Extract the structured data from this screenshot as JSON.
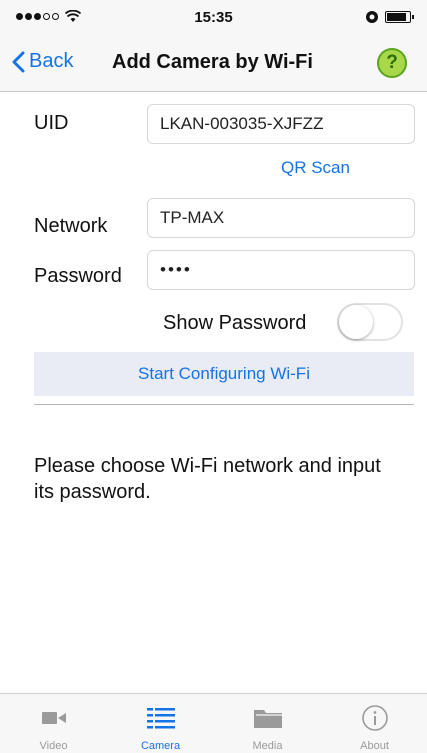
{
  "status_bar": {
    "time": "15:35",
    "icons": [
      "signal-dots-icon",
      "wifi-icon",
      "alarm-icon",
      "battery-icon"
    ]
  },
  "nav": {
    "back_label": "Back",
    "title": "Add Camera by Wi-Fi",
    "help_symbol": "?"
  },
  "form": {
    "uid_label": "UID",
    "uid_value": "LKAN-003035-XJFZZ",
    "qr_scan_label": "QR Scan",
    "network_label": "Network",
    "network_value": "TP-MAX",
    "password_label": "Password",
    "password_value": "••••",
    "show_password_label": "Show Password",
    "show_password_on": false
  },
  "config_button_label": "Start Configuring Wi-Fi",
  "message": "Please choose Wi-Fi network and input its password.",
  "tabs": [
    {
      "label": "Video",
      "icon": "video-camera-icon",
      "active": false
    },
    {
      "label": "Camera",
      "icon": "camera-list-icon",
      "active": true
    },
    {
      "label": "Media",
      "icon": "folder-icon",
      "active": false
    },
    {
      "label": "About",
      "icon": "info-icon",
      "active": false
    }
  ],
  "colors": {
    "accent": "#1473e6",
    "help_green": "#a8d84a",
    "button_bg": "#e9ecf5",
    "tab_inactive": "#9a9a9a"
  }
}
